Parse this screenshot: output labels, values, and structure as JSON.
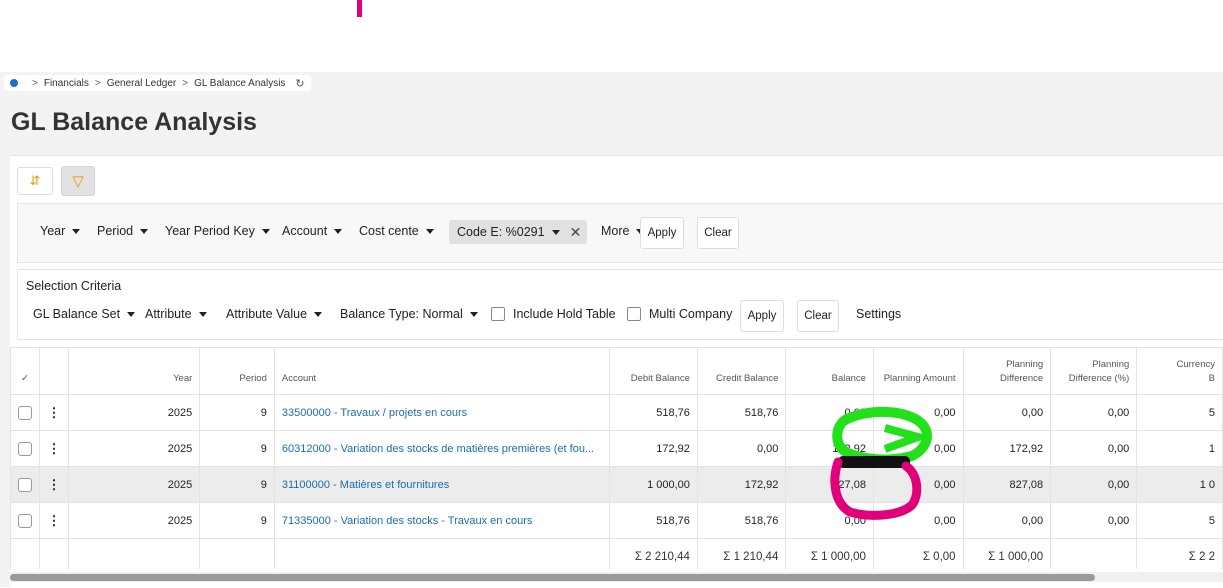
{
  "breadcrumb": {
    "items": [
      "Financials",
      "General Ledger",
      "GL Balance Analysis"
    ],
    "separator": ">",
    "refresh_icon": "↻"
  },
  "page": {
    "title": "GL Balance Analysis"
  },
  "toolbar": {
    "sort_icon": "⇵",
    "filter_icon": "▽"
  },
  "filters": {
    "items": [
      "Year",
      "Period",
      "Year Period Key",
      "Account",
      "Cost cente"
    ],
    "chip": "Code E: %0291",
    "more": "More",
    "apply": "Apply",
    "clear": "Clear"
  },
  "selection": {
    "title": "Selection Criteria",
    "items": [
      "GL Balance Set",
      "Attribute",
      "Attribute Value",
      "Balance Type: Normal"
    ],
    "include_hold": "Include Hold Table",
    "multi_company": "Multi Company",
    "apply": "Apply",
    "clear": "Clear",
    "settings": "Settings"
  },
  "table": {
    "check_header": "✓",
    "columns": [
      "Year",
      "Period",
      "Account",
      "Debit Balance",
      "Credit Balance",
      "Balance",
      "Planning Amount",
      "Planning\nDifference",
      "Planning\nDifference (%)",
      "Currency\nB"
    ],
    "rows": [
      {
        "year": "2025",
        "period": "9",
        "account": "33500000 - Travaux / projets  en cours",
        "debit": "518,76",
        "credit": "518,76",
        "balance": "0,00",
        "plan_amt": "0,00",
        "plan_diff": "0,00",
        "plan_pct": "0,00",
        "curr": "5"
      },
      {
        "year": "2025",
        "period": "9",
        "account": "60312000 - Variation des stocks de matières premières (et fou...",
        "debit": "172,92",
        "credit": "0,00",
        "balance": "172,92",
        "plan_amt": "0,00",
        "plan_diff": "172,92",
        "plan_pct": "0,00",
        "curr": "1"
      },
      {
        "year": "2025",
        "period": "9",
        "account": "31100000 - Matières et fournitures",
        "debit": "1 000,00",
        "credit": "172,92",
        "balance": "827,08",
        "plan_amt": "0,00",
        "plan_diff": "827,08",
        "plan_pct": "0,00",
        "curr": "1 0"
      },
      {
        "year": "2025",
        "period": "9",
        "account": "71335000 - Variation des stocks - Travaux en cours",
        "debit": "518,76",
        "credit": "518,76",
        "balance": "0,00",
        "plan_amt": "0,00",
        "plan_diff": "0,00",
        "plan_pct": "0,00",
        "curr": "5"
      }
    ],
    "totals": {
      "debit": "Σ 2 210,44",
      "credit": "Σ 1 210,44",
      "balance": "Σ 1 000,00",
      "plan_amt": "Σ 0,00",
      "plan_diff": "Σ 1 000,00",
      "curr": "Σ 2 2"
    }
  },
  "colors": {
    "link": "#1a6ea8",
    "annotation_green": "#22e01a",
    "annotation_magenta": "#e0007a"
  }
}
